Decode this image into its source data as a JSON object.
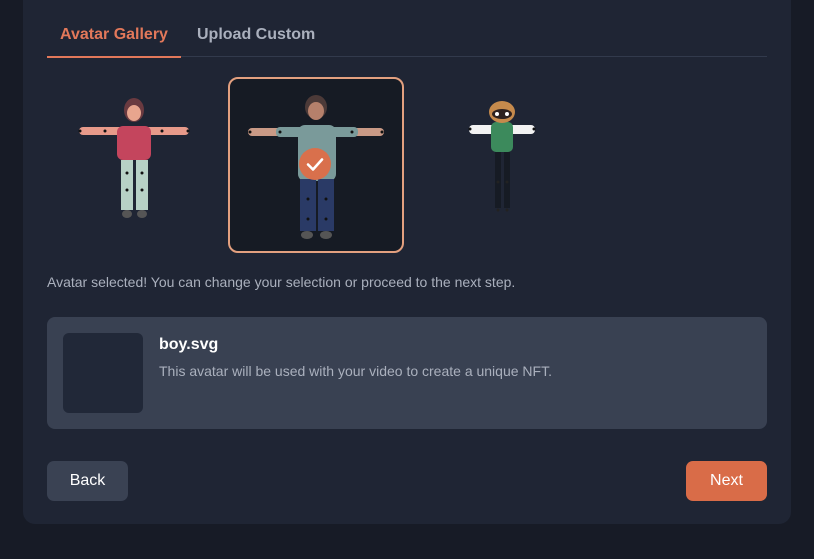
{
  "tabs": [
    {
      "label": "Avatar Gallery",
      "active": true
    },
    {
      "label": "Upload Custom",
      "active": false
    }
  ],
  "gallery": {
    "avatars": [
      {
        "name": "girl",
        "selected": false
      },
      {
        "name": "boy",
        "selected": true
      },
      {
        "name": "raccoon",
        "selected": false
      }
    ],
    "selected_icon": "check-icon"
  },
  "status_message": "Avatar selected! You can change your selection or proceed to the next step.",
  "selection": {
    "file_name": "boy.svg",
    "description": "This avatar will be used with your video to create a unique NFT."
  },
  "actions": {
    "back_label": "Back",
    "next_label": "Next"
  },
  "colors": {
    "accent": "#e2785a",
    "next_button": "#d96c48",
    "panel": "#394152",
    "background": "#171b26"
  }
}
